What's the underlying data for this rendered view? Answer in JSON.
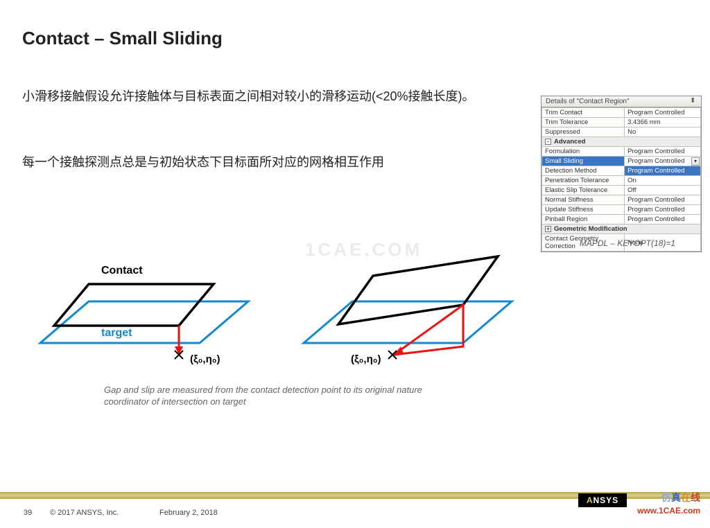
{
  "title": "Contact – Small Sliding",
  "paragraph1": "小滑移接触假设允许接触体与目标表面之间相对较小的滑移运动(<20%接触长度)。",
  "paragraph2": "每一个接触探测点总是与初始状态下目标面所对应的网格相互作用",
  "watermark": "1CAE.COM",
  "details": {
    "header": "Details of \"Contact Region\"",
    "rows": [
      {
        "label": "Trim Contact",
        "value": "Program Controlled"
      },
      {
        "label": "Trim Tolerance",
        "value": "3.4366 mm"
      },
      {
        "label": "Suppressed",
        "value": "No"
      },
      {
        "label": "Advanced",
        "section": true
      },
      {
        "label": "Formulation",
        "value": "Program Controlled"
      },
      {
        "label": "Small Sliding",
        "value": "Program Controlled",
        "selected": true
      },
      {
        "label": "Detection Method",
        "value": "Program Controlled",
        "value_selected": true
      },
      {
        "label": "Penetration Tolerance",
        "value": "On"
      },
      {
        "label": "Elastic Slip Tolerance",
        "value": "Off"
      },
      {
        "label": "Normal Stiffness",
        "value": "Program Controlled"
      },
      {
        "label": "Update Stiffness",
        "value": "Program Controlled"
      },
      {
        "label": "Pinball Region",
        "value": "Program Controlled"
      },
      {
        "label": "Geometric Modification",
        "section": true,
        "toggle": "+"
      },
      {
        "label": "Contact Geometry Correction",
        "value": "None"
      }
    ],
    "mapdl_caption": "MAPDL – KEYOPT(18)=1"
  },
  "diagram": {
    "left_labels": {
      "contact": "Contact",
      "target": "target"
    },
    "coord": "(ξ₀,η₀)",
    "caption": "Gap and slip are measured from the contact detection point to its original nature coordinator of intersection on target"
  },
  "footer": {
    "page": "39",
    "copyright": "© 2017 ANSYS, Inc.",
    "date": "February 2, 2018",
    "ansys": "NSYS",
    "brand_cn": [
      "仿",
      "真",
      "在",
      "线"
    ],
    "brand_url": "www.1CAE.com"
  }
}
